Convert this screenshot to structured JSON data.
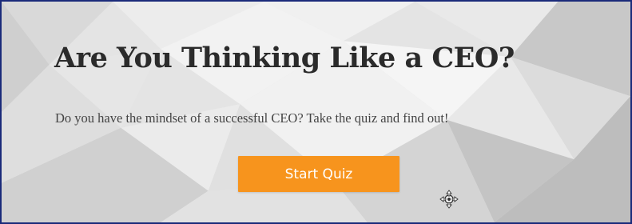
{
  "hero": {
    "title": "Are You Thinking Like a CEO?",
    "subtitle": "Do you have the mindset of a successful CEO? Take the quiz and find out!",
    "cta_label": "Start Quiz"
  },
  "colors": {
    "accent": "#f7941d",
    "title_text": "#2b2b2b",
    "body_text": "#444444",
    "frame_border": "#1a2a7a"
  },
  "icons": {
    "cursor": "move-cursor-icon"
  }
}
